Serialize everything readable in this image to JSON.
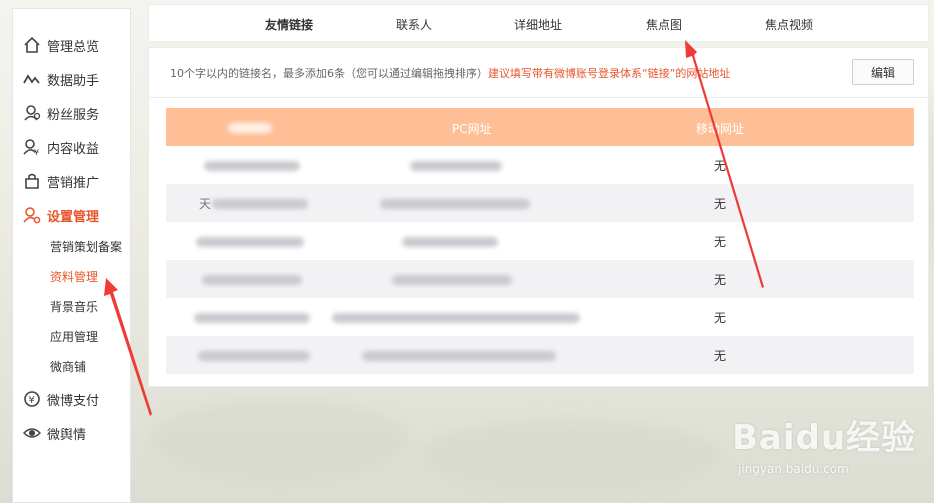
{
  "sidebar": {
    "items": [
      {
        "label": "管理总览",
        "icon": "home-icon"
      },
      {
        "label": "数据助手",
        "icon": "trend-line-icon"
      },
      {
        "label": "粉丝服务",
        "icon": "fans-icon"
      },
      {
        "label": "内容收益",
        "icon": "user-yen-icon"
      },
      {
        "label": "营销推广",
        "icon": "bag-icon"
      },
      {
        "label": "设置管理",
        "icon": "user-gear-icon"
      }
    ],
    "subitems": [
      "营销策划备案",
      "资料管理",
      "背景音乐",
      "应用管理",
      "微商铺"
    ],
    "bottom_items": [
      {
        "label": "微博支付",
        "icon": "yen-circle-icon"
      },
      {
        "label": "微舆情",
        "icon": "eye-icon"
      }
    ]
  },
  "tabs": [
    "友情链接",
    "联系人",
    "详细地址",
    "焦点图",
    "焦点视频"
  ],
  "hint": {
    "text": "10个字以内的链接名，最多添加6条（您可以通过编辑拖拽排序）",
    "warning": "建议填写带有微博账号登录体系“链接”的网站地址"
  },
  "edit_label": "编辑",
  "table": {
    "headers": [
      "",
      "PC网址",
      "移动网址"
    ],
    "rows": [
      {
        "prefix": "",
        "mobile": "无"
      },
      {
        "prefix": "天",
        "mobile": "无"
      },
      {
        "prefix": "",
        "mobile": "无"
      },
      {
        "prefix": "",
        "mobile": "无"
      },
      {
        "prefix": "",
        "mobile": "无"
      },
      {
        "prefix": "",
        "mobile": "无"
      }
    ]
  },
  "watermark": {
    "brand": "Baidu经验",
    "url": "jingyan.baidu.com"
  },
  "colors": {
    "accent": "#e8552b",
    "table_header": "#ffbf96",
    "arrow": "#ee3b35"
  }
}
